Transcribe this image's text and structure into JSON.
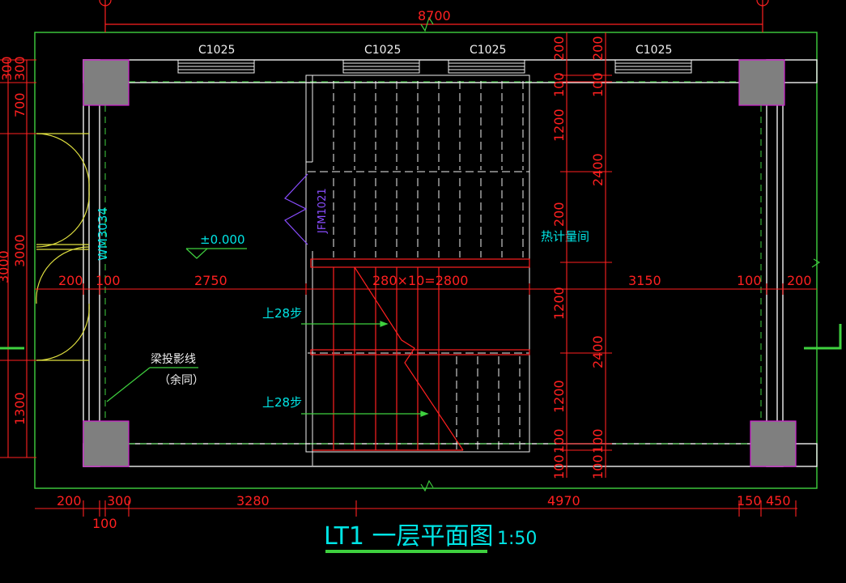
{
  "drawing": {
    "title": "LT1 一层平面图",
    "scale": "1:50",
    "level_mark": "±0.000",
    "overall_dim": "8700",
    "window_labels": [
      "C1025",
      "C1025",
      "C1025",
      "C1025"
    ],
    "door_left": "WM3034",
    "door_inner": "JFM1021",
    "room_label": "热计量间",
    "stair_up_1": "上28步",
    "stair_up_2": "上28步",
    "stair_formula": "280×10=2800",
    "beam_note": "梁投影线",
    "beam_note_2": "（余同）",
    "row_dims_mid": [
      "200",
      "100",
      "2750",
      "3150",
      "100",
      "200"
    ],
    "row_dims_bottom": [
      "200",
      "300",
      "3280",
      "4970",
      "150",
      "450"
    ],
    "dim_bottom_extra": "100",
    "left_vert_dims": [
      "300",
      "300",
      "700",
      "3000",
      "1300"
    ],
    "left_vert_outer": "3000",
    "stair_vert_dims_a": [
      "200",
      "100",
      "1200",
      "200",
      "1200",
      "1200",
      "100",
      "100"
    ],
    "stair_vert_dims_b": [
      "200",
      "100",
      "2400",
      "2400",
      "100",
      "100"
    ]
  }
}
